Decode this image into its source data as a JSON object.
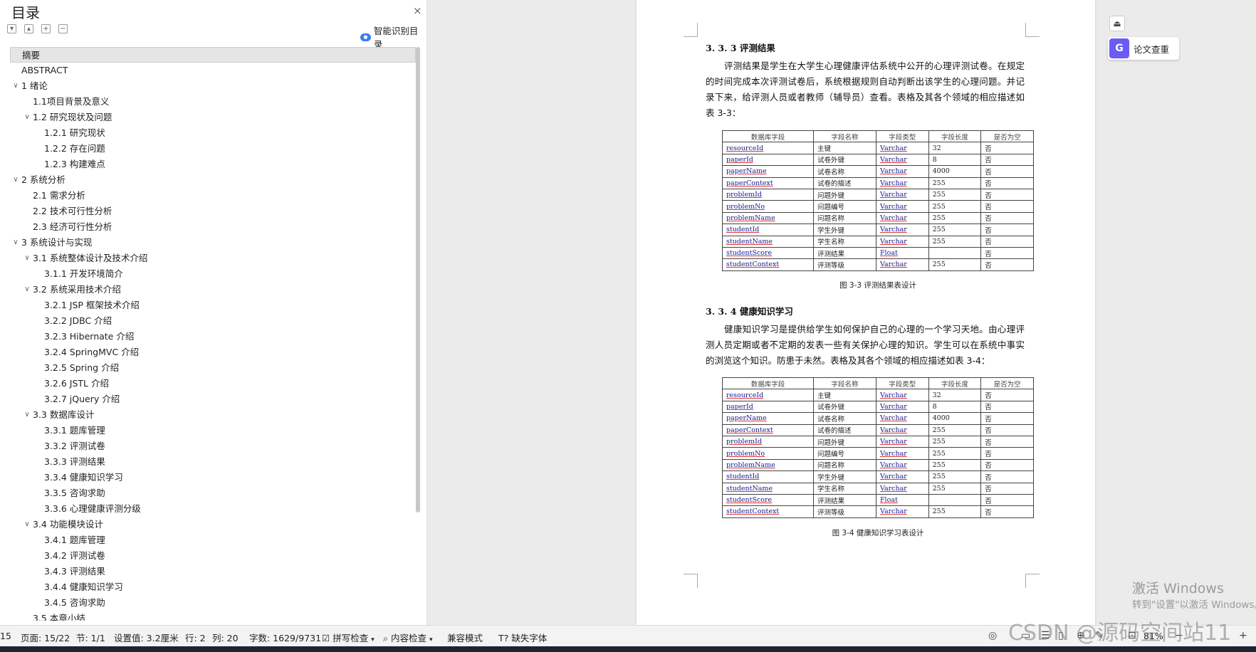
{
  "toc": {
    "title": "目录",
    "close_icon": "×",
    "smart_toc_label": "智能识别目录",
    "items": [
      {
        "label": "摘要",
        "level": 1,
        "chev": "",
        "selected": true
      },
      {
        "label": "ABSTRACT",
        "level": 1,
        "chev": ""
      },
      {
        "label": "1  绪论",
        "level": 1,
        "chev": "∨"
      },
      {
        "label": "1.1项目背景及意义",
        "level": 2,
        "chev": ""
      },
      {
        "label": "1.2  研究现状及问题",
        "level": 2,
        "chev": "∨"
      },
      {
        "label": "1.2.1  研究现状",
        "level": 3,
        "chev": ""
      },
      {
        "label": "1.2.2  存在问题",
        "level": 3,
        "chev": ""
      },
      {
        "label": "1.2.3  构建难点",
        "level": 3,
        "chev": ""
      },
      {
        "label": "2  系统分析",
        "level": 1,
        "chev": "∨"
      },
      {
        "label": "2.1  需求分析",
        "level": 2,
        "chev": ""
      },
      {
        "label": "2.2  技术可行性分析",
        "level": 2,
        "chev": ""
      },
      {
        "label": "2.3  经济可行性分析",
        "level": 2,
        "chev": ""
      },
      {
        "label": "3  系统设计与实现",
        "level": 1,
        "chev": "∨"
      },
      {
        "label": "3.1 系统整体设计及技术介绍",
        "level": 2,
        "chev": "∨"
      },
      {
        "label": "3.1.1  开发环境简介",
        "level": 3,
        "chev": ""
      },
      {
        "label": "3.2  系统采用技术介绍",
        "level": 2,
        "chev": "∨"
      },
      {
        "label": "3.2.1 JSP 框架技术介绍",
        "level": 3,
        "chev": ""
      },
      {
        "label": "3.2.2 JDBC 介绍",
        "level": 3,
        "chev": ""
      },
      {
        "label": "3.2.3 Hibernate 介绍",
        "level": 3,
        "chev": ""
      },
      {
        "label": "3.2.4 SpringMVC 介绍",
        "level": 3,
        "chev": ""
      },
      {
        "label": "3.2.5 Spring 介绍",
        "level": 3,
        "chev": ""
      },
      {
        "label": "3.2.6 JSTL 介绍",
        "level": 3,
        "chev": ""
      },
      {
        "label": "3.2.7 jQuery 介绍",
        "level": 3,
        "chev": ""
      },
      {
        "label": "3.3  数据库设计",
        "level": 2,
        "chev": "∨"
      },
      {
        "label": "3.3.1  题库管理",
        "level": 3,
        "chev": ""
      },
      {
        "label": "3.3.2  评测试卷",
        "level": 3,
        "chev": ""
      },
      {
        "label": "3.3.3  评测结果",
        "level": 3,
        "chev": ""
      },
      {
        "label": "3.3.4  健康知识学习",
        "level": 3,
        "chev": ""
      },
      {
        "label": "3.3.5  咨询求助",
        "level": 3,
        "chev": ""
      },
      {
        "label": "3.3.6  心理健康评测分级",
        "level": 3,
        "chev": ""
      },
      {
        "label": "3.4  功能模块设计",
        "level": 2,
        "chev": "∨"
      },
      {
        "label": "3.4.1  题库管理",
        "level": 3,
        "chev": ""
      },
      {
        "label": "3.4.2  评测试卷",
        "level": 3,
        "chev": ""
      },
      {
        "label": "3.4.3  评测结果",
        "level": 3,
        "chev": ""
      },
      {
        "label": "3.4.4  健康知识学习",
        "level": 3,
        "chev": ""
      },
      {
        "label": "3.4.5  咨询求助",
        "level": 3,
        "chev": ""
      },
      {
        "label": "3.5  本章小结",
        "level": 2,
        "chev": ""
      }
    ]
  },
  "doc": {
    "section1": {
      "heading": "3. 3. 3  评测结果",
      "paragraph": "评测结果是学生在大学生心理健康评估系统中公开的心理评测试卷。在规定的时间完成本次评测试卷后，系统根据规则自动判断出该学生的心理问题。并记录下来，给评测人员或者教师（辅导员）查看。表格及其各个领域的相应描述如表 3-3：",
      "caption": "图 3-3  评测结果表设计"
    },
    "section2": {
      "heading": "3. 3. 4  健康知识学习",
      "paragraph": "健康知识学习是提供给学生如何保护自己的心理的一个学习天地。由心理评测人员定期或者不定期的发表一些有关保护心理的知识。学生可以在系统中事实的浏览这个知识。防患于未然。表格及其各个领域的相应描述如表 3-4：",
      "caption": "图 3-4  健康知识学习表设计"
    },
    "table_headers": [
      "数据库字段",
      "字段名称",
      "字段类型",
      "字段长度",
      "是否为空"
    ],
    "table_rows": [
      [
        "resourceId",
        "主键",
        "Varchar",
        "32",
        "否"
      ],
      [
        "paperId",
        "试卷外键",
        "Varchar",
        "8",
        "否"
      ],
      [
        "paperName",
        "试卷名称",
        "Varchar",
        "4000",
        "否"
      ],
      [
        "paperContext",
        "试卷的描述",
        "Varchar",
        "255",
        "否"
      ],
      [
        "problemId",
        "问题外键",
        "Varchar",
        "255",
        "否"
      ],
      [
        "problemNo",
        "问题编号",
        "Varchar",
        "255",
        "否"
      ],
      [
        "problemName",
        "问题名称",
        "Varchar",
        "255",
        "否"
      ],
      [
        "studentId",
        "学生外键",
        "Varchar",
        "255",
        "否"
      ],
      [
        "studentName",
        "学生名称",
        "Varchar",
        "255",
        "否"
      ],
      [
        "studentScore",
        "评测结果",
        "Float",
        "",
        "否"
      ],
      [
        "studentContext",
        "评测等级",
        "Varchar",
        "255",
        "否"
      ]
    ]
  },
  "right_panel": {
    "paper_check_label": "论文查重",
    "paper_check_icon": "G",
    "windows_activate_title": "激活 Windows",
    "windows_activate_sub": "转到\"设置\"以激活 Windows。"
  },
  "status_bar": {
    "page_prefix": "15",
    "page": "页面: 15/22",
    "section": "节: 1/1",
    "setting": "设置值: 3.2厘米",
    "row": "行: 2",
    "col": "列: 20",
    "word_count": "字数: 1629/9731",
    "spell_check": "拼写检查",
    "content_check": "内容检查",
    "compat_mode": "兼容模式",
    "missing_font": "缺失字体",
    "zoom": "81%"
  },
  "watermark": "CSDN @源码空间站11"
}
